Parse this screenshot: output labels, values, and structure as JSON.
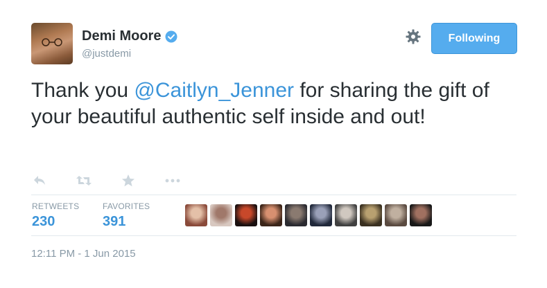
{
  "tweet": {
    "author_name": "Demi Moore",
    "author_handle": "@justdemi",
    "follow_label": "Following",
    "text_before": "Thank you ",
    "mention": "@Caitlyn_Jenner",
    "text_after": " for sharing the gift of your beautiful authentic self inside and out!",
    "timestamp": "12:11 PM - 1 Jun 2015"
  },
  "actions": [
    {
      "icon": "reply-icon"
    },
    {
      "icon": "retweet-icon"
    },
    {
      "icon": "favorite-star-icon"
    },
    {
      "icon": "more-dots-icon"
    }
  ],
  "stats": {
    "retweets_label": "RETWEETS",
    "retweets_value": "230",
    "favorites_label": "FAVORITES",
    "favorites_value": "391"
  },
  "favoriter_avatars": [
    {
      "color_a": "#8a4a3a",
      "color_b": "#e4c0a8"
    },
    {
      "color_a": "#d8c8c0",
      "color_b": "#a0786a"
    },
    {
      "color_a": "#1a1010",
      "color_b": "#c8482a"
    },
    {
      "color_a": "#3a2418",
      "color_b": "#d89070"
    },
    {
      "color_a": "#2a2a30",
      "color_b": "#8a7a70"
    },
    {
      "color_a": "#20283a",
      "color_b": "#9aa0b8"
    },
    {
      "color_a": "#404040",
      "color_b": "#d0c8c0"
    },
    {
      "color_a": "#3a3020",
      "color_b": "#b8a070"
    },
    {
      "color_a": "#5a4a40",
      "color_b": "#c0b0a0"
    },
    {
      "color_a": "#181818",
      "color_b": "#a07060"
    }
  ],
  "colors": {
    "accent": "#55acee",
    "link": "#3b94d9",
    "muted": "#8899a6",
    "text": "#292f33"
  }
}
